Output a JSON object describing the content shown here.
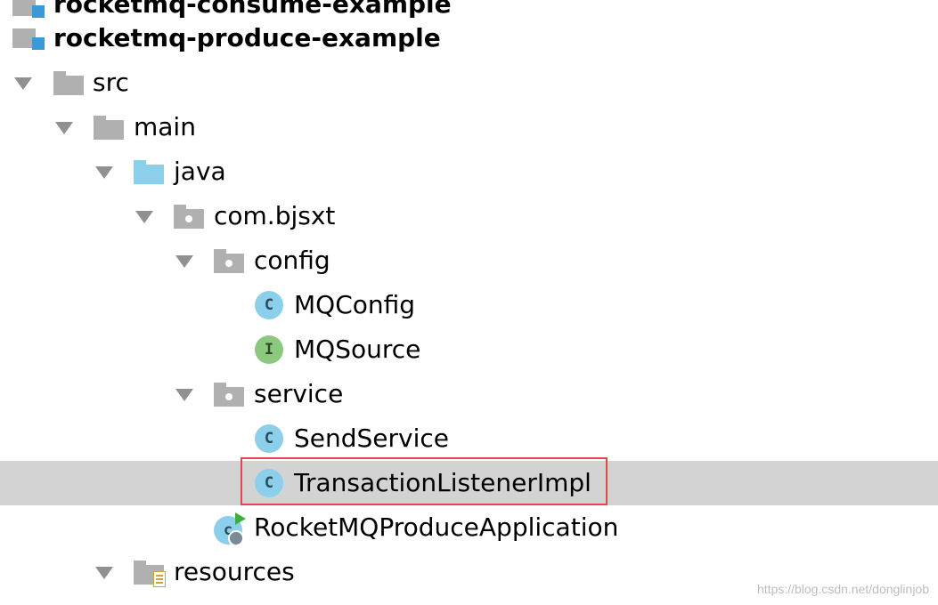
{
  "colors": {
    "folder_gray": "#b0b0b0",
    "folder_blue": "#8ccfea",
    "class_blue": "#8ccfea",
    "interface_green": "#8cc97e",
    "selection": "#d3d3d3",
    "highlight_border": "#e0474c",
    "arrow": "#909090"
  },
  "tree": {
    "consume_module": {
      "label": "rocketmq-consume-example",
      "icon": "module-icon"
    },
    "produce_module": {
      "label": "rocketmq-produce-example",
      "icon": "module-icon"
    },
    "src": {
      "label": "src",
      "icon": "folder-icon",
      "expanded": true
    },
    "main": {
      "label": "main",
      "icon": "folder-icon",
      "expanded": true
    },
    "java": {
      "label": "java",
      "icon": "source-folder-icon",
      "expanded": true
    },
    "package_root": {
      "label": "com.bjsxt",
      "icon": "package-icon",
      "expanded": true
    },
    "config_pkg": {
      "label": "config",
      "icon": "package-icon",
      "expanded": true
    },
    "mqconfig": {
      "label": "MQConfig",
      "icon": "class-icon",
      "badge": "C"
    },
    "mqsource": {
      "label": "MQSource",
      "icon": "interface-icon",
      "badge": "I"
    },
    "service_pkg": {
      "label": "service",
      "icon": "package-icon",
      "expanded": true
    },
    "sendservice": {
      "label": "SendService",
      "icon": "class-icon",
      "badge": "C"
    },
    "transaction_listener": {
      "label": "TransactionListenerImpl",
      "icon": "class-icon",
      "badge": "C",
      "selected": true
    },
    "application": {
      "label": "RocketMQProduceApplication",
      "icon": "spring-boot-class-icon"
    },
    "resources": {
      "label": "resources",
      "icon": "resources-folder-icon",
      "expanded": true
    }
  },
  "watermark": "https://blog.csdn.net/donglinjob"
}
